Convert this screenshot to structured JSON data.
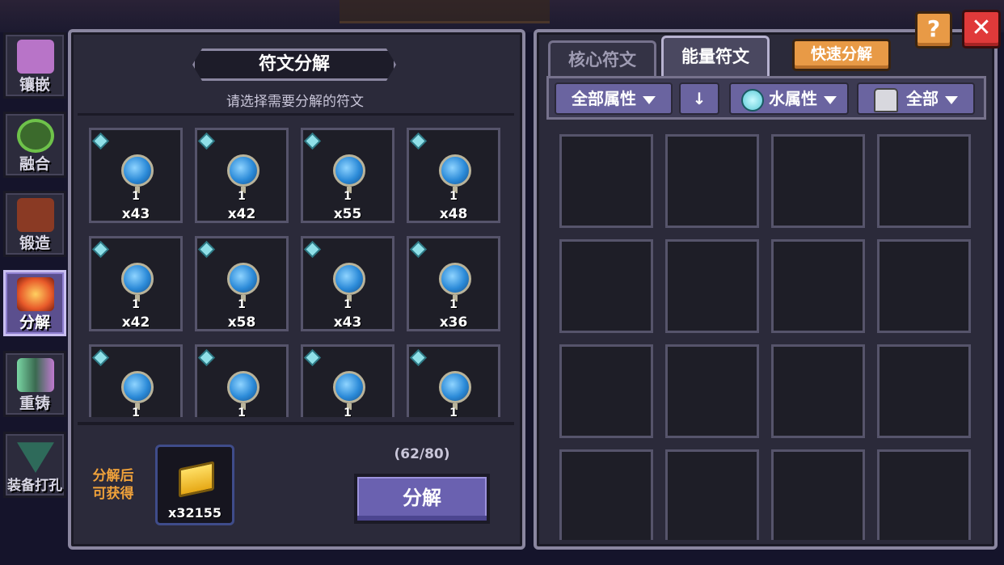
{
  "nav": [
    {
      "label": "镶嵌",
      "icon": "inlay-icon",
      "color": "#b874c8"
    },
    {
      "label": "融合",
      "icon": "fusion-icon",
      "color": "#6ec24a"
    },
    {
      "label": "锻造",
      "icon": "forge-icon",
      "color": "#c8562e"
    },
    {
      "label": "分解",
      "icon": "decompose-icon",
      "color": "#e85a2a"
    },
    {
      "label": "重铸",
      "icon": "recast-icon",
      "color": "#7ad6a4"
    },
    {
      "label": "装备打孔",
      "icon": "socket-icon",
      "color": "#4aa88a"
    }
  ],
  "left": {
    "title": "符文分解",
    "subtitle": "请选择需要分解的符文",
    "runes": [
      {
        "level": "1",
        "count": "x43"
      },
      {
        "level": "1",
        "count": "x42"
      },
      {
        "level": "1",
        "count": "x55"
      },
      {
        "level": "1",
        "count": "x48"
      },
      {
        "level": "1",
        "count": "x42"
      },
      {
        "level": "1",
        "count": "x58"
      },
      {
        "level": "1",
        "count": "x43"
      },
      {
        "level": "1",
        "count": "x36"
      },
      {
        "level": "1",
        "count": ""
      },
      {
        "level": "1",
        "count": ""
      },
      {
        "level": "1",
        "count": ""
      },
      {
        "level": "1",
        "count": ""
      }
    ],
    "yield_label_1": "分解后",
    "yield_label_2": "可获得",
    "yield_count": "x32155",
    "capacity": "(62/80)",
    "decompose_button": "分解"
  },
  "right": {
    "tabs": {
      "core": "核心符文",
      "energy": "能量符文"
    },
    "quick_button": "快速分解",
    "filters": {
      "all_attributes": "全部属性",
      "sort_arrow": "↓",
      "water": "水属性",
      "all": "全部"
    }
  },
  "help_label": "?",
  "close_label": "✕",
  "colors": {
    "accent": "#6a61b0",
    "orange": "#e89a46",
    "close": "#e03a3a",
    "rune_blue": "#2b8ad8"
  }
}
